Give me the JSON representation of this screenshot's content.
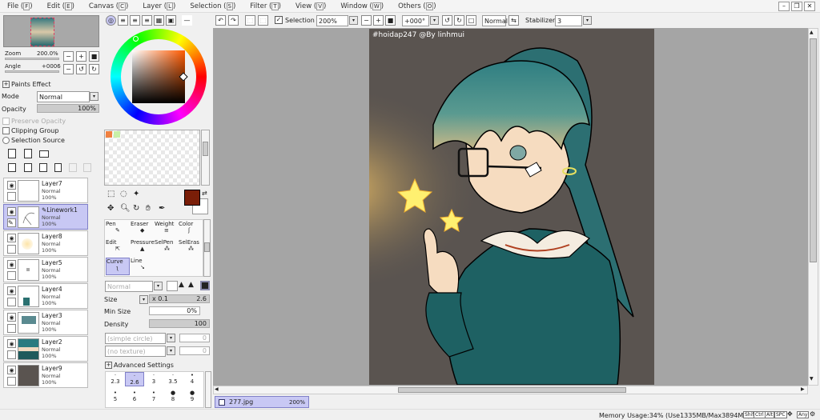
{
  "menu": [
    "File",
    "Edit",
    "Canvas",
    "Layer",
    "Selection",
    "Filter",
    "View",
    "Window",
    "Others"
  ],
  "menu_keys": [
    "F",
    "E",
    "C",
    "L",
    "S",
    "T",
    "V",
    "W",
    "O"
  ],
  "nav": {
    "zoom_label": "Zoom",
    "zoom_value": "200.0%",
    "angle_label": "Angle",
    "angle_value": "+0006"
  },
  "paints_effect": "Paints Effect",
  "mode_label": "Mode",
  "mode_value": "Normal",
  "opacity_label": "Opacity",
  "opacity_value": "100%",
  "preserve_opacity": "Preserve Opacity",
  "clipping_group": "Clipping Group",
  "selection_source": "Selection Source",
  "layers": [
    {
      "name": "Layer7",
      "mode": "Normal",
      "opacity": "100%"
    },
    {
      "name": "Linework1",
      "mode": "Normal",
      "opacity": "100%"
    },
    {
      "name": "Layer8",
      "mode": "Normal",
      "opacity": "100%"
    },
    {
      "name": "Layer5",
      "mode": "Normal",
      "opacity": "100%"
    },
    {
      "name": "Layer4",
      "mode": "Normal",
      "opacity": "100%"
    },
    {
      "name": "Layer3",
      "mode": "Normal",
      "opacity": "100%"
    },
    {
      "name": "Layer2",
      "mode": "Normal",
      "opacity": "100%"
    },
    {
      "name": "Layer9",
      "mode": "Normal",
      "opacity": "100%"
    }
  ],
  "tools": [
    {
      "label": "Pen"
    },
    {
      "label": "Eraser"
    },
    {
      "label": "Weight"
    },
    {
      "label": "Color"
    },
    {
      "label": "Edit"
    },
    {
      "label": "Pressure"
    },
    {
      "label": "SelPen"
    },
    {
      "label": "SelEras"
    },
    {
      "label": "Curve"
    },
    {
      "label": "Line"
    }
  ],
  "brush": {
    "blend": "Normal",
    "size_label": "Size",
    "size_mult": "x 0.1",
    "size_value": "2.6",
    "minsize_label": "Min Size",
    "minsize_value": "0%",
    "density_label": "Density",
    "density_value": "100",
    "shape": "(simple circle)",
    "shape_val": "0",
    "texture": "(no texture)",
    "texture_val": "0",
    "advanced": "Advanced Settings",
    "sizes_row1": [
      "2.3",
      "2.6",
      "3",
      "3.5",
      "4"
    ],
    "sizes_row2": [
      "5",
      "6",
      "7",
      "8",
      "9"
    ]
  },
  "toolbar": {
    "selection_label": "Selection",
    "zoom": "200%",
    "angle": "+000°",
    "blend": "Normal",
    "stabilizer_label": "Stabilizer",
    "stabilizer_value": "3"
  },
  "canvas": {
    "watermark": "#hoidap247 @By linhmui"
  },
  "tab": {
    "name": "277.jpg",
    "zoom": "200%"
  },
  "status": {
    "memory": "Memory Usage:34% (Use1335MB/Max3894MB)",
    "keys": [
      "Shift",
      "Ctrl",
      "Alt",
      "SPC",
      "Any"
    ]
  },
  "colors": {
    "main": "#7a1e08",
    "accent": "#c8c8f4"
  }
}
